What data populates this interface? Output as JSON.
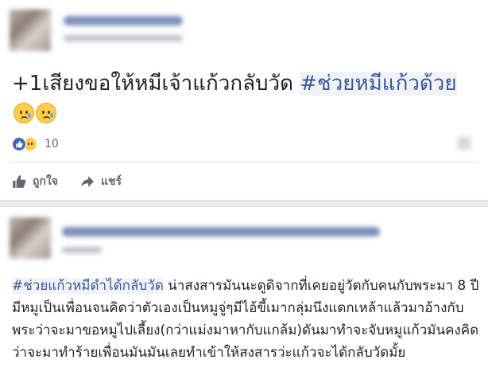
{
  "post1": {
    "text_prefix": "+1เสียงขอให้หมีเจ้าแก้วกลับวัด ",
    "hashtag": "#ช่วยหมีแก้วด้วย",
    "emojis": [
      "crying-face",
      "crying-face"
    ],
    "reaction_count": "10",
    "actions": {
      "like_label": "ถูกใจ",
      "share_label": "แชร์"
    }
  },
  "post2": {
    "hashtag_1": "#ช่วยแก้วหมีดำได้กลับวัด",
    "text": " น่าสงสารมันนะดูดิจากที่เคยอยู่วัดกับคนกับพระมา 8 ปีมีหมูเป็นเพื่อนจนคิดว่าตัวเองเป็นหมูจู่ๆมีไอ้ขี้เมากลุ่มนึงแดกเหล้าแล้วมาอ้างกับพระว่าจะมาขอหมูไปเลี้ยง(กว่าแม่งมาหากับแกล้ม)ดันมาทำจะจับหมูแก้วมันคงคิดว่าจะมาทำร้ายเพื่อนมันมันเลยทำเข้าให้สงสารว่ะแก้วจะได้กลับวัดมั้ย"
  },
  "colors": {
    "link": "#365899",
    "like_blue": "#4267b2",
    "muted": "#606770"
  }
}
